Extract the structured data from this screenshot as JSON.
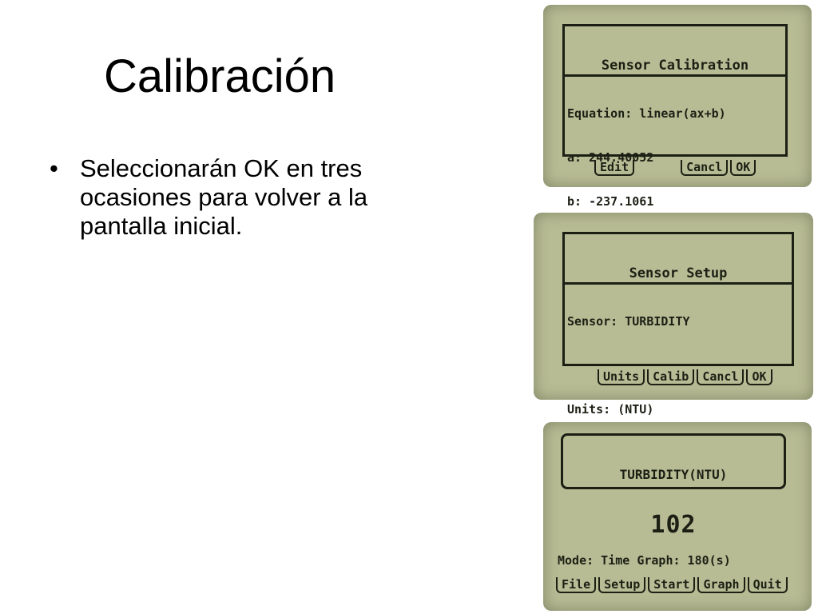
{
  "slide": {
    "title": "Calibración",
    "bullets": [
      "Seleccionarán OK en tres ocasiones para volver a la pantalla inicial."
    ]
  },
  "screens": [
    {
      "title": "Sensor Calibration",
      "lines": [
        "Equation: linear(ax+b)",
        "a: 244.40052",
        "b: -237.1061"
      ],
      "softkeys": [
        "Edit",
        "Cancl",
        "OK"
      ]
    },
    {
      "title": "Sensor Setup",
      "lines": [
        "Sensor: TURBIDITY",
        "",
        "Units: (NTU)"
      ],
      "softkeys": [
        "Units",
        "Calib",
        "Cancl",
        "OK"
      ]
    },
    {
      "reading_label": "TURBIDITY(NTU)",
      "reading_value": "102",
      "mode": "Mode: Time Graph: 180(s)",
      "softkeys": [
        "File",
        "Setup",
        "Start",
        "Graph",
        "Quit"
      ]
    }
  ],
  "colors": {
    "lcd_background": "#b8bc95",
    "lcd_ink": "#1c2014"
  }
}
